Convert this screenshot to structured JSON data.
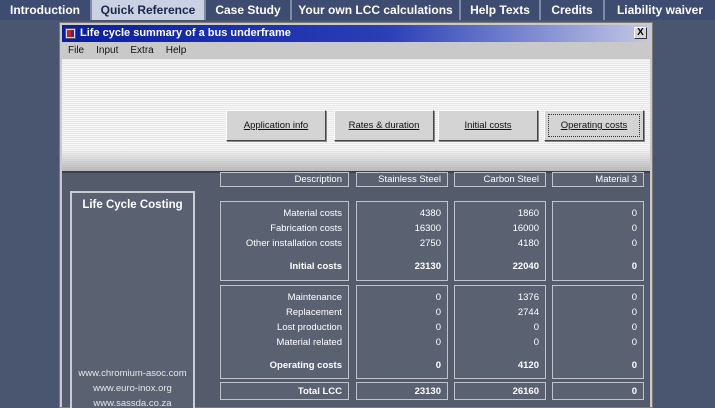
{
  "nav": {
    "tabs": [
      {
        "label": "Introduction",
        "active": false
      },
      {
        "label": "Quick Reference",
        "active": true
      },
      {
        "label": "Case Study",
        "active": false
      },
      {
        "label": "Your own LCC calculations",
        "active": false
      },
      {
        "label": "Help Texts",
        "active": false
      },
      {
        "label": "Credits",
        "active": false
      },
      {
        "label": "Liability  waiver",
        "active": false
      }
    ]
  },
  "window": {
    "title": "Life cycle summary of a bus underframe",
    "close_label": "X",
    "menu": [
      "File",
      "Input",
      "Extra",
      "Help"
    ]
  },
  "buttons": [
    {
      "label": "Application info",
      "active": false
    },
    {
      "label": "Rates & duration",
      "active": false
    },
    {
      "label": "Initial costs",
      "active": false
    },
    {
      "label": "Operating costs",
      "active": true
    }
  ],
  "sidebar": {
    "heading": "Life Cycle Costing",
    "links": [
      "www.chromium-asoc.com",
      "www.euro-inox.org",
      "www.sassda.co.za"
    ]
  },
  "table": {
    "headers": [
      "Description",
      "Stainless Steel",
      "Carbon Steel",
      "Material 3"
    ],
    "initial": {
      "rows": [
        {
          "label": "Material costs",
          "values": [
            "4380",
            "1860",
            "0"
          ]
        },
        {
          "label": "Fabrication costs",
          "values": [
            "16300",
            "16000",
            "0"
          ]
        },
        {
          "label": "Other installation costs",
          "values": [
            "2750",
            "4180",
            "0"
          ]
        }
      ],
      "total": {
        "label": "Initial costs",
        "values": [
          "23130",
          "22040",
          "0"
        ]
      }
    },
    "operating": {
      "rows": [
        {
          "label": "Maintenance",
          "values": [
            "0",
            "1376",
            "0"
          ]
        },
        {
          "label": "Replacement",
          "values": [
            "0",
            "2744",
            "0"
          ]
        },
        {
          "label": "Lost production",
          "values": [
            "0",
            "0",
            "0"
          ]
        },
        {
          "label": "Material related",
          "values": [
            "0",
            "0",
            "0"
          ]
        }
      ],
      "total": {
        "label": "Operating costs",
        "values": [
          "0",
          "4120",
          "0"
        ]
      }
    },
    "grand_total": {
      "label": "Total LCC",
      "values": [
        "23130",
        "26160",
        "0"
      ]
    }
  }
}
